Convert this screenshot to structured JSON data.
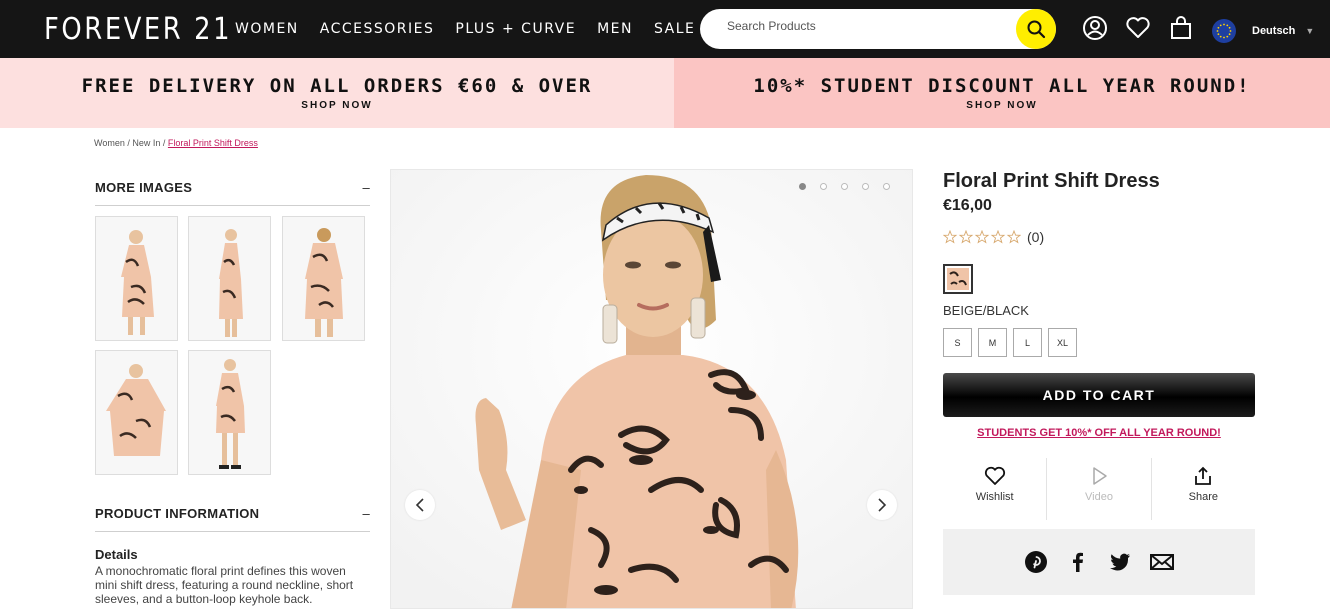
{
  "header": {
    "logo": "FOREVER 21",
    "nav": [
      "WOMEN",
      "ACCESSORIES",
      "PLUS + CURVE",
      "MEN",
      "SALE"
    ],
    "search_placeholder": "Search Products",
    "language": "Deutsch",
    "icons": [
      "search-icon",
      "account-icon",
      "heart-icon",
      "bag-icon",
      "eu-flag-icon"
    ]
  },
  "promos": [
    {
      "title": "FREE DELIVERY ON ALL ORDERS €60 & OVER",
      "cta": "SHOP NOW",
      "color": "#fde0df"
    },
    {
      "title": "10%* STUDENT DISCOUNT ALL YEAR ROUND!",
      "cta": "SHOP NOW",
      "color": "#fbc5c3"
    }
  ],
  "breadcrumb": {
    "part1": "Women",
    "sep": " / ",
    "part2": "New In",
    "current": "Floral Print Shift Dress"
  },
  "left": {
    "more_images": "MORE IMAGES",
    "toggle": "–",
    "product_info": "PRODUCT INFORMATION",
    "details_title": "Details",
    "details_text": "A monochromatic floral print defines this woven mini shift dress, featuring a round neckline, short sleeves, and a button-loop keyhole back."
  },
  "gallery": {
    "slide_count": 5,
    "active_slide": 1
  },
  "product": {
    "title": "Floral Print Shift Dress",
    "price": "€16,00",
    "rating": 0,
    "rating_count": "(0)",
    "color": "BEIGE/BLACK",
    "sizes": [
      "S",
      "M",
      "L",
      "XL"
    ],
    "add_to_cart": "ADD TO CART",
    "student_link": "STUDENTS GET 10%* OFF ALL YEAR ROUND!",
    "actions": [
      {
        "label": "Wishlist",
        "icon": "heart-icon"
      },
      {
        "label": "Video",
        "icon": "play-icon"
      },
      {
        "label": "Share",
        "icon": "share-icon"
      }
    ],
    "social": [
      "pinterest-icon",
      "facebook-icon",
      "twitter-icon",
      "email-icon"
    ]
  },
  "colors": {
    "accent_yellow": "#ffee00",
    "link_pink": "#c2185b",
    "dress_beige": "#f0c4a8"
  }
}
